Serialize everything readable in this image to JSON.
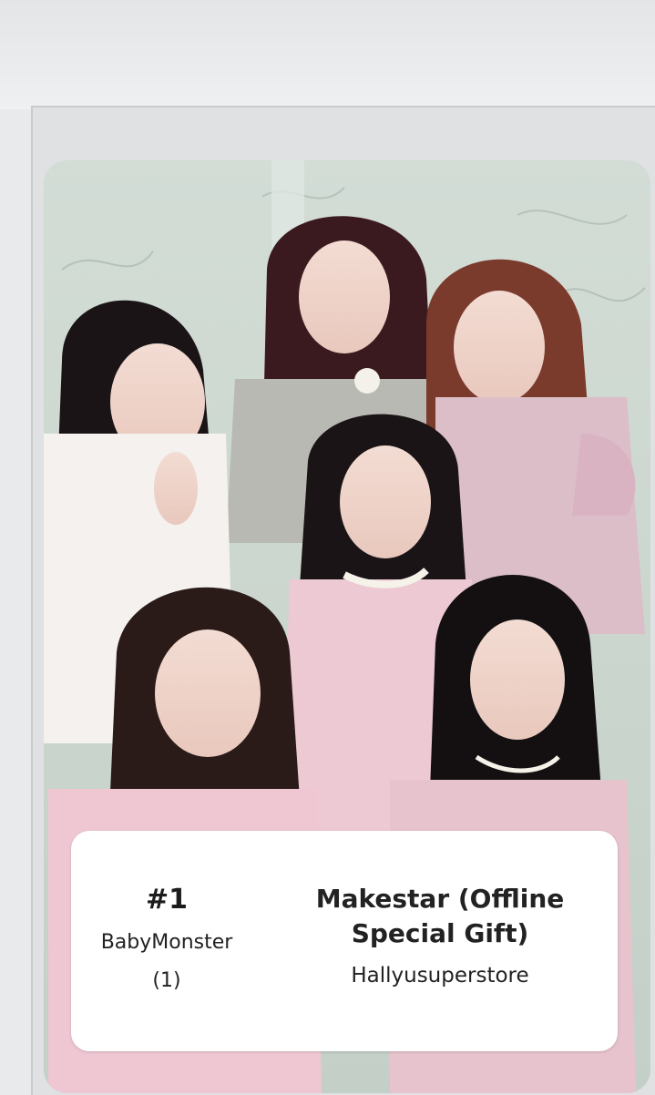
{
  "label": {
    "number": "#1",
    "group": "BabyMonster",
    "count": "(1)",
    "event_line1": "Makestar (Offline",
    "event_line2": "Special Gift)",
    "store": "Hallyusuperstore"
  },
  "colors": {
    "background_wall": "#cdd9d2",
    "hair_dark": "#1a1416",
    "hair_red": "#7a3a2c",
    "outfit_pink": "#ecc9d3",
    "outfit_white": "#f4f1ee"
  },
  "photo": {
    "subject": "photocard-group-photo"
  }
}
